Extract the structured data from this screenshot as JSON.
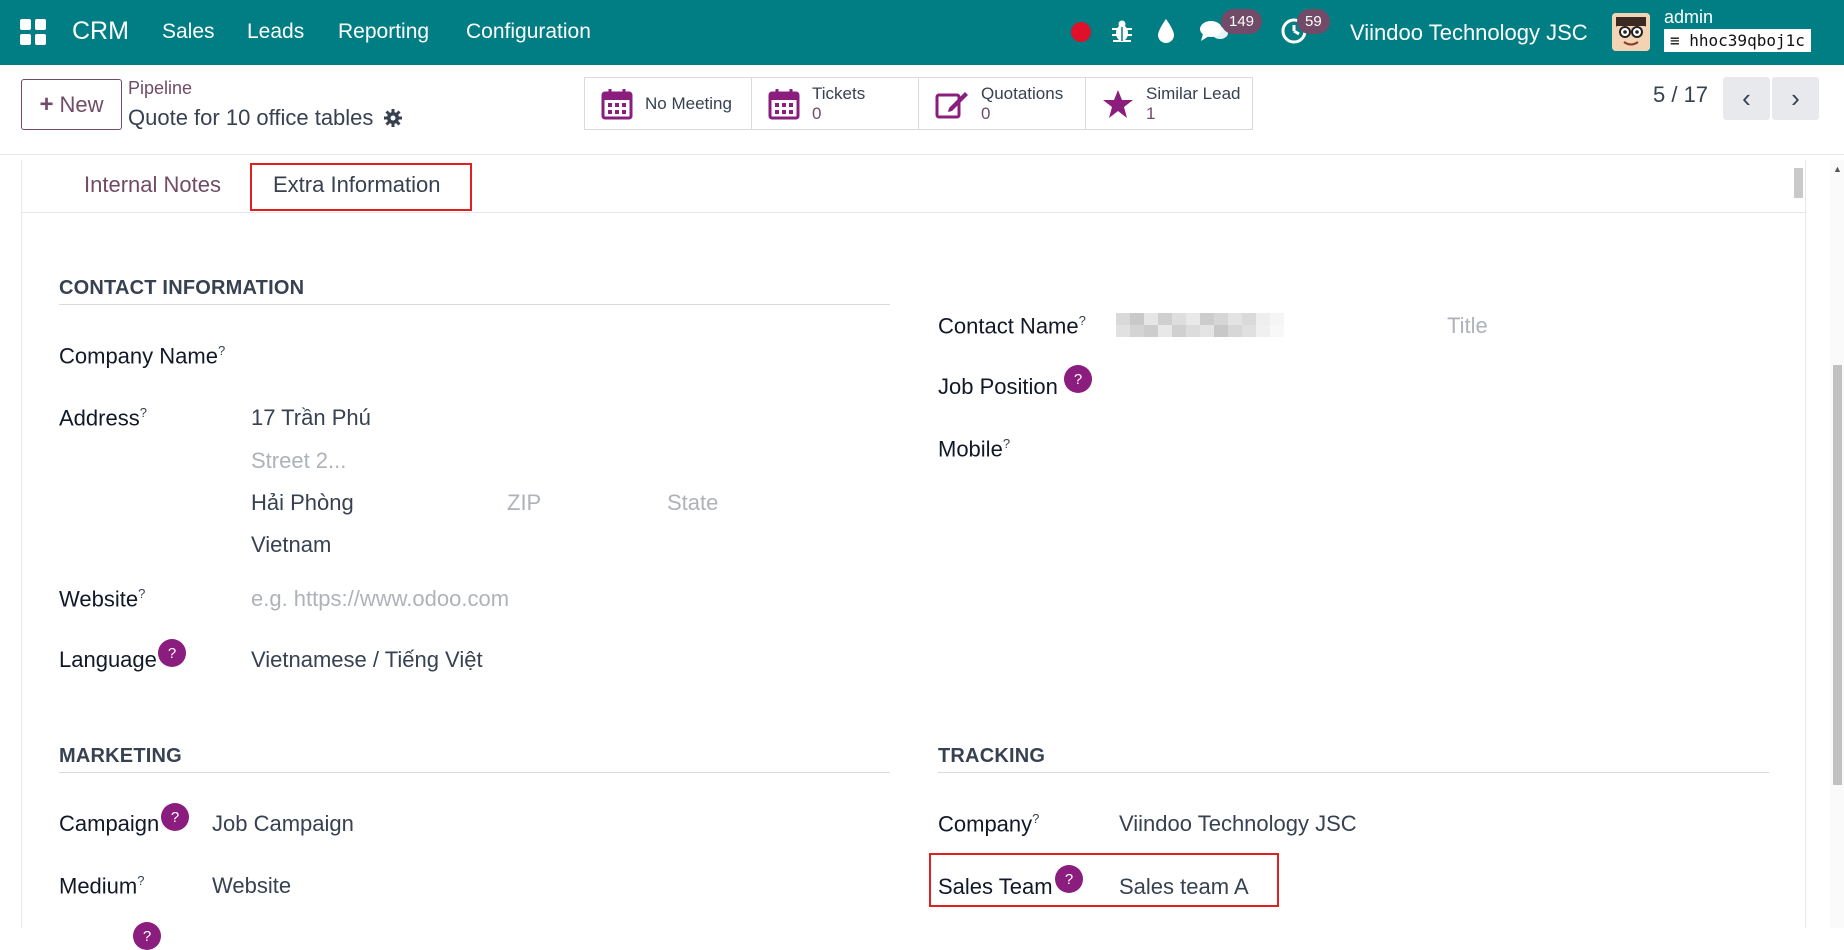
{
  "topbar": {
    "brand": "CRM",
    "menu": [
      "Sales",
      "Leads",
      "Reporting",
      "Configuration"
    ],
    "messages_count": "149",
    "activities_count": "59",
    "company": "Viindoo Technology JSC",
    "user": "admin",
    "database": "hhoc39qboj1c"
  },
  "control": {
    "new_label": "New",
    "breadcrumb": "Pipeline",
    "record_name": "Quote for 10 office tables",
    "smart_buttons": {
      "meeting": {
        "label": "No Meeting"
      },
      "tickets": {
        "label": "Tickets",
        "value": "0"
      },
      "quotations": {
        "label": "Quotations",
        "value": "0"
      },
      "similar": {
        "label": "Similar Lead",
        "value": "1"
      }
    },
    "pager": "5 / 17"
  },
  "tabs": {
    "internal_notes": "Internal Notes",
    "extra_information": "Extra Information"
  },
  "contact": {
    "section": "CONTACT INFORMATION",
    "company_name_label": "Company Name",
    "address_label": "Address",
    "street": "17 Trần Phú",
    "street2_placeholder": "Street 2...",
    "city": "Hải Phòng",
    "zip_placeholder": "ZIP",
    "state_placeholder": "State",
    "country": "Vietnam",
    "website_label": "Website",
    "website_placeholder": "e.g. https://www.odoo.com",
    "language_label": "Language",
    "language": "Vietnamese / Tiếng Việt",
    "contact_name_label": "Contact Name",
    "title_placeholder": "Title",
    "job_position_label": "Job Position",
    "mobile_label": "Mobile"
  },
  "marketing": {
    "section": "MARKETING",
    "campaign_label": "Campaign",
    "campaign": "Job Campaign",
    "medium_label": "Medium",
    "medium": "Website"
  },
  "tracking": {
    "section": "TRACKING",
    "company_label": "Company",
    "company": "Viindoo Technology JSC",
    "sales_team_label": "Sales Team",
    "sales_team": "Sales team A"
  },
  "help_mark": "?",
  "colors": {
    "topbar": "#017e84",
    "accent": "#714b67",
    "help_badge": "#8a1d7e",
    "highlight": "#e02020"
  }
}
